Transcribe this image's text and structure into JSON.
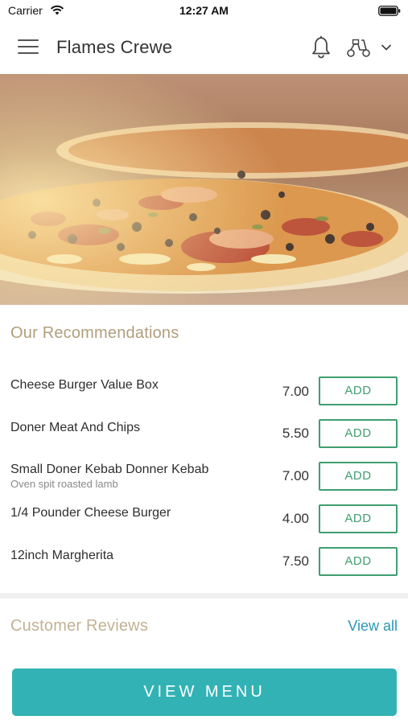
{
  "status_bar": {
    "carrier": "Carrier",
    "time": "12:27 AM"
  },
  "header": {
    "title": "Flames Crewe"
  },
  "recommendations": {
    "heading": "Our Recommendations",
    "items": [
      {
        "name": "Cheese Burger Value Box",
        "description": "",
        "price": "7.00",
        "add_label": "ADD"
      },
      {
        "name": "Doner Meat And Chips",
        "description": "",
        "price": "5.50",
        "add_label": "ADD"
      },
      {
        "name": "Small Doner Kebab Donner Kebab",
        "description": "Oven spit roasted lamb",
        "price": "7.00",
        "add_label": "ADD"
      },
      {
        "name": "1/4 Pounder Cheese Burger",
        "description": "",
        "price": "4.00",
        "add_label": "ADD"
      },
      {
        "name": "12inch Margherita",
        "description": "",
        "price": "7.50",
        "add_label": "ADD"
      }
    ]
  },
  "reviews": {
    "heading": "Customer Reviews",
    "view_all": "View all"
  },
  "footer": {
    "view_menu": "VIEW MENU"
  },
  "colors": {
    "accent_green": "#3f9e70",
    "heading_tan": "#b19e7d",
    "link_blue": "#2a98b5",
    "menu_button_teal": "#32b2b5"
  },
  "icons": [
    "wifi-icon",
    "battery-icon",
    "menu-icon",
    "bell-icon",
    "scooter-icon",
    "chevron-down-icon"
  ]
}
